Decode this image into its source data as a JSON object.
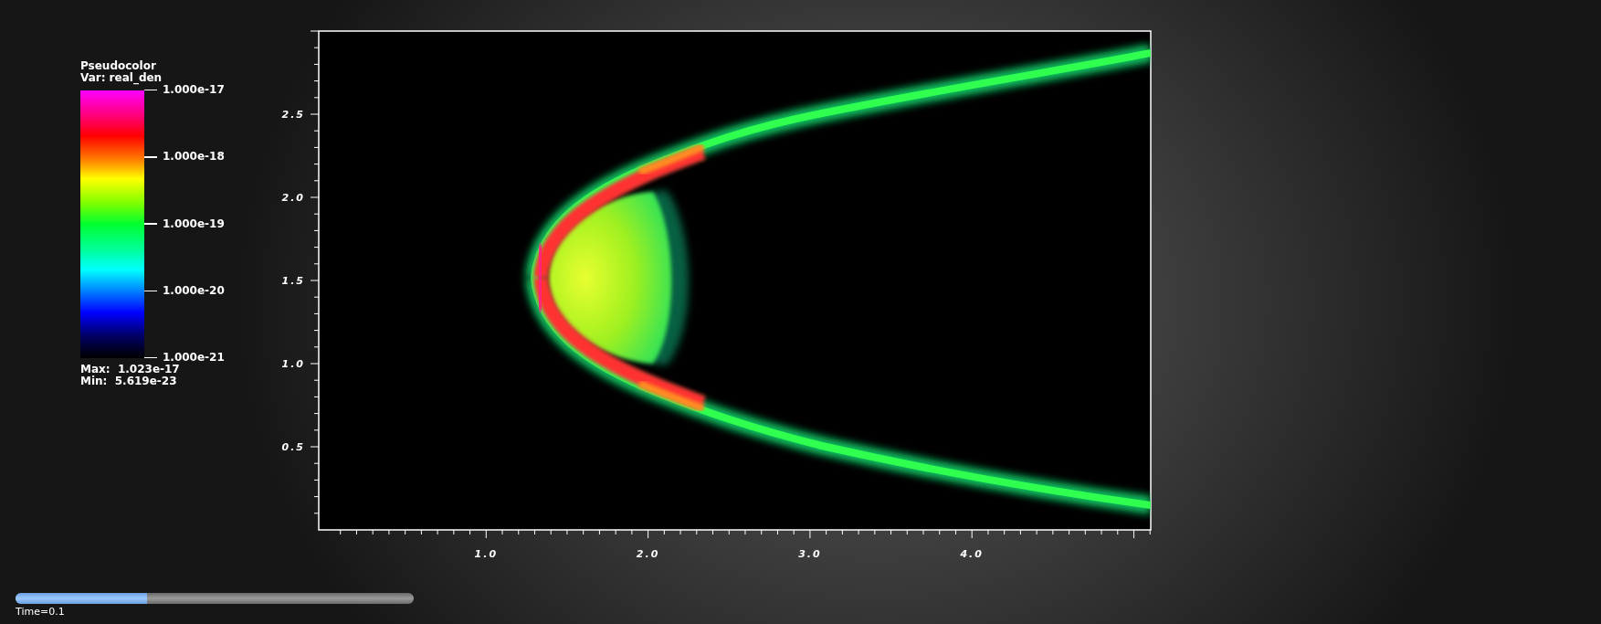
{
  "legend": {
    "title": "Pseudocolor",
    "variable": "Var: real_den",
    "ticks": [
      "1.000e-17",
      "1.000e-18",
      "1.000e-19",
      "1.000e-20",
      "1.000e-21"
    ],
    "max": "Max:  1.023e-17",
    "min": "Min:  5.619e-23"
  },
  "plot": {
    "y_ticks": [
      "2.5",
      "2.0",
      "1.5",
      "1.0",
      "0.5"
    ],
    "x_ticks": [
      "1.0",
      "2.0",
      "3.0",
      "4.0"
    ]
  },
  "time_slider": {
    "level": 0.33,
    "label": "Time=0.1"
  }
}
